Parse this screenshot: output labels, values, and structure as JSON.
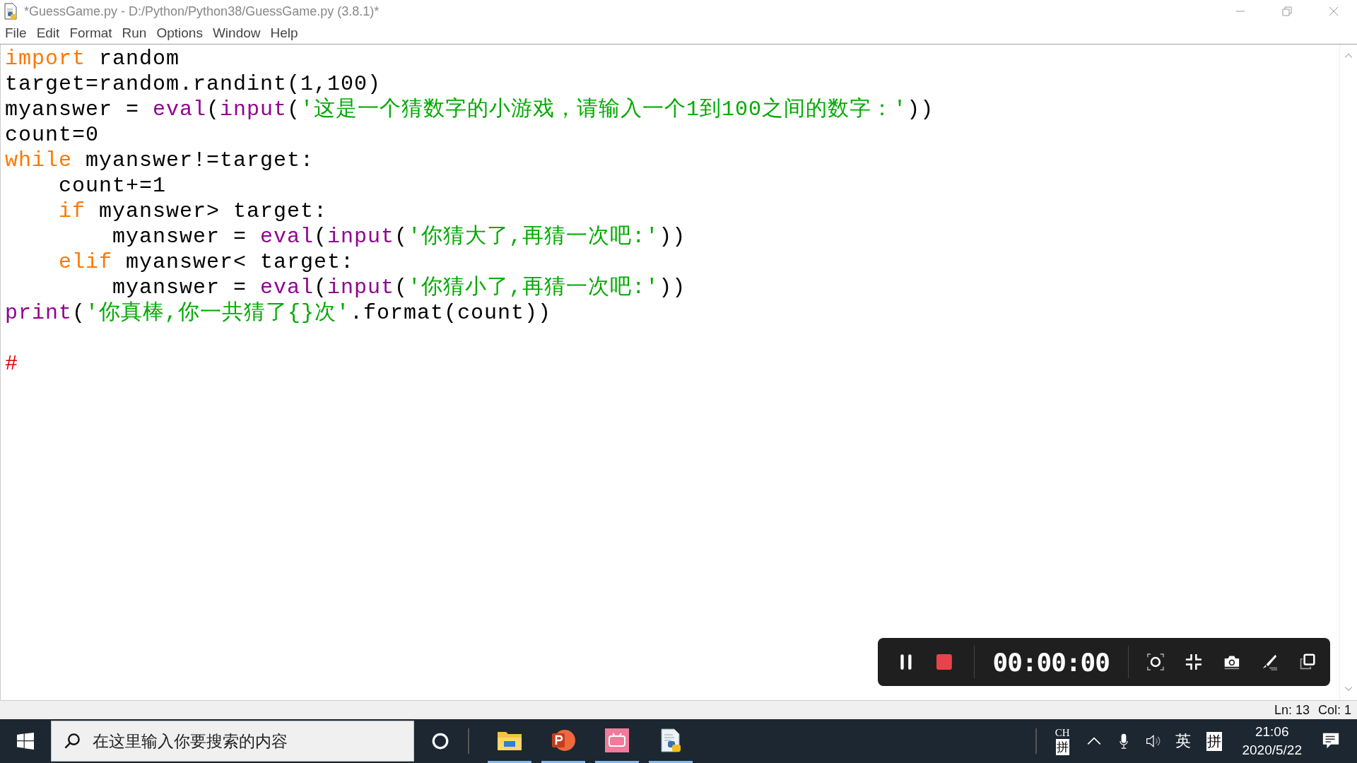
{
  "window": {
    "title": "*GuessGame.py - D:/Python/Python38/GuessGame.py (3.8.1)*"
  },
  "menu": [
    "File",
    "Edit",
    "Format",
    "Run",
    "Options",
    "Window",
    "Help"
  ],
  "code_lines": [
    {
      "tokens": [
        {
          "kind": "keyword",
          "text": "import"
        },
        {
          "kind": "plain",
          "text": " random"
        }
      ]
    },
    {
      "tokens": [
        {
          "kind": "plain",
          "text": "target=random.randint(1,100)"
        }
      ]
    },
    {
      "tokens": [
        {
          "kind": "plain",
          "text": "myanswer = "
        },
        {
          "kind": "builtin",
          "text": "eval"
        },
        {
          "kind": "plain",
          "text": "("
        },
        {
          "kind": "builtin",
          "text": "input"
        },
        {
          "kind": "plain",
          "text": "("
        },
        {
          "kind": "string",
          "text": "'这是一个猜数字的小游戏，请输入一个1到100之间的数字：'"
        },
        {
          "kind": "plain",
          "text": "))"
        }
      ]
    },
    {
      "tokens": [
        {
          "kind": "plain",
          "text": "count=0"
        }
      ]
    },
    {
      "tokens": [
        {
          "kind": "keyword",
          "text": "while"
        },
        {
          "kind": "plain",
          "text": " myanswer!=target:"
        }
      ]
    },
    {
      "tokens": [
        {
          "kind": "plain",
          "text": "    count+=1"
        }
      ]
    },
    {
      "tokens": [
        {
          "kind": "keyword",
          "text": "    if"
        },
        {
          "kind": "plain",
          "text": " myanswer> target:"
        }
      ]
    },
    {
      "tokens": [
        {
          "kind": "plain",
          "text": "        myanswer = "
        },
        {
          "kind": "builtin",
          "text": "eval"
        },
        {
          "kind": "plain",
          "text": "("
        },
        {
          "kind": "builtin",
          "text": "input"
        },
        {
          "kind": "plain",
          "text": "("
        },
        {
          "kind": "string",
          "text": "'你猜大了,再猜一次吧:'"
        },
        {
          "kind": "plain",
          "text": "))"
        }
      ]
    },
    {
      "tokens": [
        {
          "kind": "keyword",
          "text": "    elif"
        },
        {
          "kind": "plain",
          "text": " myanswer< target:"
        }
      ]
    },
    {
      "tokens": [
        {
          "kind": "plain",
          "text": "        myanswer = "
        },
        {
          "kind": "builtin",
          "text": "eval"
        },
        {
          "kind": "plain",
          "text": "("
        },
        {
          "kind": "builtin",
          "text": "input"
        },
        {
          "kind": "plain",
          "text": "("
        },
        {
          "kind": "string",
          "text": "'你猜小了,再猜一次吧:'"
        },
        {
          "kind": "plain",
          "text": "))"
        }
      ]
    },
    {
      "tokens": [
        {
          "kind": "builtin",
          "text": "print"
        },
        {
          "kind": "plain",
          "text": "("
        },
        {
          "kind": "string",
          "text": "'你真棒,你一共猜了{}次'"
        },
        {
          "kind": "plain",
          "text": ".format(count))"
        }
      ]
    },
    {
      "kind": "blank"
    },
    {
      "tokens": [
        {
          "kind": "comment",
          "text": "#"
        }
      ]
    }
  ],
  "recorder": {
    "timer": "00:00:00"
  },
  "status_bar": {
    "line": "Ln: 13",
    "column": "Col: 1"
  },
  "taskbar": {
    "search": {
      "placeholder": "在这里输入你要搜索的内容"
    },
    "apps": [
      {
        "kind": "explorer",
        "active": true
      },
      {
        "kind": "powerpoint",
        "active": true
      },
      {
        "kind": "bilibili",
        "active": true
      },
      {
        "kind": "python-file",
        "active": true
      }
    ],
    "tray": {
      "input_lang": "CH",
      "ime_mode": "拼",
      "lang": "英",
      "ime": "拼",
      "time": "21:06",
      "date": "2020/5/22"
    }
  }
}
